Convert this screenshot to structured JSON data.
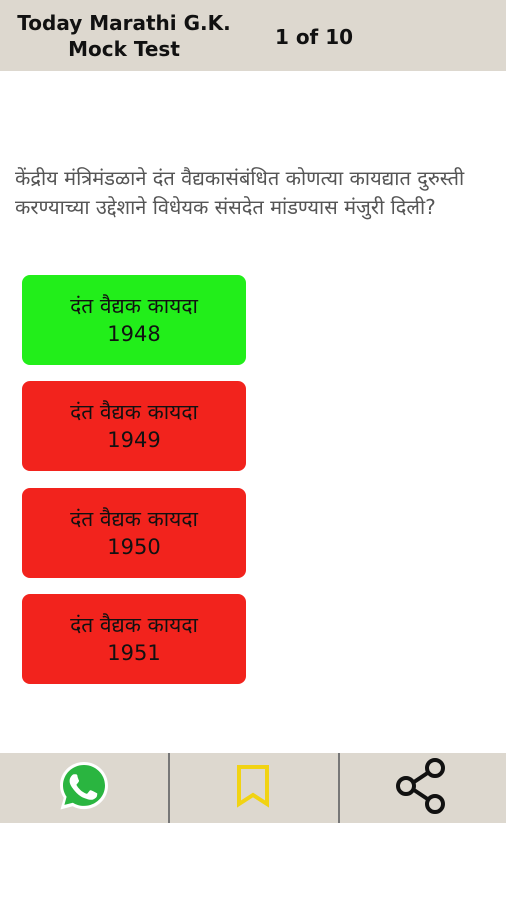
{
  "header": {
    "title": "Today Marathi G.K.\nMock Test",
    "progress": "1 of 10"
  },
  "question": {
    "text": "केंद्रीय मंत्रिमंडळाने दंत वैद्यकासंबंधित कोणत्या कायद्यात दुरुस्ती करण्याच्या उद्देशाने विधेयक संसदेत मांडण्यास मंजुरी दिली?"
  },
  "options": [
    {
      "line1": "दंत वैद्यक कायदा",
      "line2": "1948",
      "state": "correct",
      "color": "#22ee1a"
    },
    {
      "line1": "दंत वैद्यक कायदा",
      "line2": "1949",
      "state": "wrong",
      "color": "#f2231d"
    },
    {
      "line1": "दंत वैद्यक कायदा",
      "line2": "1950",
      "state": "wrong",
      "color": "#f2231d"
    },
    {
      "line1": "दंत वैद्यक कायदा",
      "line2": "1951",
      "state": "wrong",
      "color": "#f2231d"
    }
  ],
  "bottom_bar": {
    "items": [
      {
        "icon": "whatsapp-icon"
      },
      {
        "icon": "bookmark-icon",
        "color": "#f1d313"
      },
      {
        "icon": "share-icon"
      }
    ]
  }
}
